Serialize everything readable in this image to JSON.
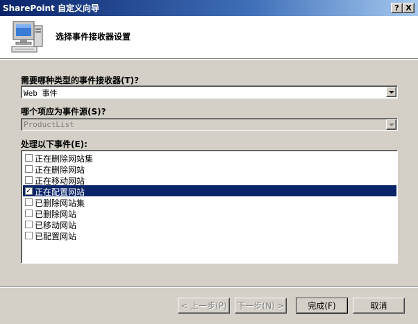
{
  "window": {
    "title": "SharePoint 自定义向导",
    "help_glyph": "?",
    "close_glyph": "X"
  },
  "banner": {
    "icon": "computer-wizard-icon",
    "title": "选择事件接收器设置"
  },
  "receiver_type": {
    "label": "需要哪种类型的事件接收器(T)?",
    "value": "Web 事件",
    "enabled": true
  },
  "event_source": {
    "label": "哪个项应为事件源(S)?",
    "value": "ProductList",
    "enabled": false
  },
  "events": {
    "label": "处理以下事件(E):",
    "items": [
      {
        "label": "正在删除网站集",
        "checked": false,
        "selected": false
      },
      {
        "label": "正在删除网站",
        "checked": false,
        "selected": false
      },
      {
        "label": "正在移动网站",
        "checked": false,
        "selected": false
      },
      {
        "label": "正在配置网站",
        "checked": true,
        "selected": true
      },
      {
        "label": "已删除网站集",
        "checked": false,
        "selected": false
      },
      {
        "label": "已删除网站",
        "checked": false,
        "selected": false
      },
      {
        "label": "已移动网站",
        "checked": false,
        "selected": false
      },
      {
        "label": "已配置网站",
        "checked": false,
        "selected": false
      }
    ],
    "check_glyph": "✓"
  },
  "buttons": {
    "back": "< 上一步(P)",
    "next": "下一步(N) >",
    "finish": "完成(F)",
    "cancel": "取消"
  },
  "colors": {
    "title_bar": "#0a246a",
    "selection": "#0a246a",
    "face": "#d4d0c8"
  }
}
